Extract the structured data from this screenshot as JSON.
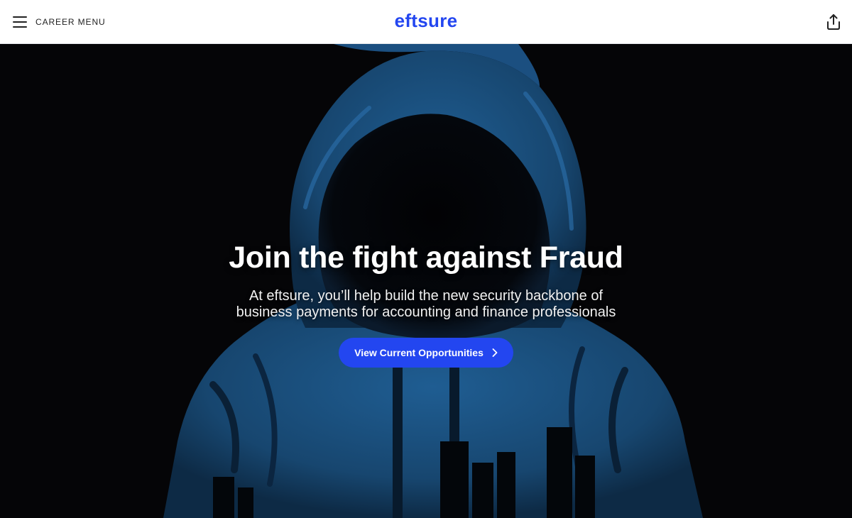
{
  "header": {
    "menu_label": "CAREER MENU",
    "logo_text": "eftsure",
    "share_icon": "share-upload-icon"
  },
  "hero": {
    "headline": "Join the fight against Fraud",
    "subtitle_line1": "At eftsure, you’ll help build the new security backbone of",
    "subtitle_line2": "business payments for accounting and finance professionals",
    "cta_label": "View Current Opportunities",
    "cta_icon": "chevron-right-icon",
    "background_image": "hooded-figure-illustration"
  },
  "colors": {
    "brand_blue": "#2346f0",
    "hero_background": "#050507",
    "hood_blue": "#1b4f80"
  }
}
